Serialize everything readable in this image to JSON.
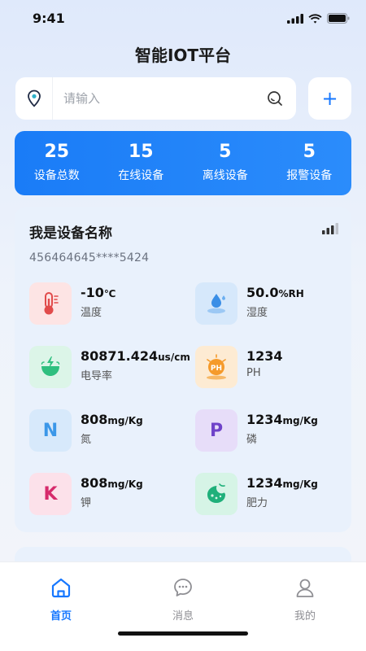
{
  "status_bar": {
    "time": "9:41"
  },
  "header": {
    "title": "智能IOT平台"
  },
  "search": {
    "placeholder": "请输入",
    "add_label": "+"
  },
  "stats": [
    {
      "value": "25",
      "label": "设备总数"
    },
    {
      "value": "15",
      "label": "在线设备"
    },
    {
      "value": "5",
      "label": "离线设备"
    },
    {
      "value": "5",
      "label": "报警设备"
    }
  ],
  "device": {
    "name": "我是设备名称",
    "id": "456464645****5424",
    "sensors": {
      "temperature": {
        "value": "-10",
        "unit": "℃",
        "label": "温度"
      },
      "humidity": {
        "value": "50.0",
        "unit": "%RH",
        "label": "湿度"
      },
      "conductivity": {
        "value": "80871.424",
        "unit": "us/cm",
        "label": "电导率"
      },
      "ph": {
        "value": "1234",
        "unit": "",
        "label": "PH",
        "icon_text": "PH"
      },
      "nitrogen": {
        "value": "808",
        "unit": "mg/Kg",
        "label": "氮",
        "icon_text": "N"
      },
      "phosphorus": {
        "value": "1234",
        "unit": "mg/Kg",
        "label": "磷",
        "icon_text": "P"
      },
      "potassium": {
        "value": "808",
        "unit": "mg/Kg",
        "label": "钾",
        "icon_text": "K"
      },
      "fertility": {
        "value": "1234",
        "unit": "mg/Kg",
        "label": "肥力"
      }
    }
  },
  "tabs": [
    {
      "label": "首页",
      "icon": "home-icon",
      "active": true
    },
    {
      "label": "消息",
      "icon": "message-icon",
      "active": false
    },
    {
      "label": "我的",
      "icon": "user-icon",
      "active": false
    }
  ],
  "colors": {
    "primary": "#1677ff",
    "card_bg": "#e9f1fc"
  }
}
